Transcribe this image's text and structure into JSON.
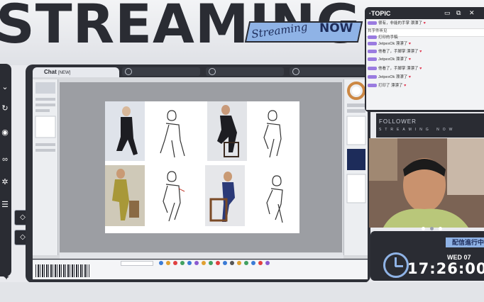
{
  "banner": {
    "word": "STREAMING",
    "tag_script": "Streaming",
    "tag_now": "NOW"
  },
  "sidebar": {
    "icons": [
      "chevron-down-icon",
      "refresh-icon",
      "eye-icon",
      "link-icon",
      "star-icon",
      "menu-icon"
    ],
    "diamond_buttons": [
      "◇",
      "◇"
    ]
  },
  "window": {
    "chat_tab": "Chat",
    "chat_tab_suffix": "[NEW]"
  },
  "topic": {
    "title": "·TOPIC",
    "rows": [
      {
        "user": "",
        "text": "很有，非能的手掌 漂漂了",
        "heart": "♥"
      },
      {
        "user": "",
        "text": "共字件听见 ",
        "heart": ""
      },
      {
        "user": "",
        "text": "打印的手稿",
        "heart": ""
      },
      {
        "user": "",
        "text": "JetpexOk 漂漂了",
        "heart": "♥"
      },
      {
        "user": "",
        "text": "他看了，手脚掌 漂漂了",
        "heart": "♥"
      },
      {
        "user": "",
        "text": "JetpexOk 漂漂了",
        "heart": "♥"
      },
      {
        "user": "",
        "text": "他看了，手脚掌 漂漂了",
        "heart": "♥"
      },
      {
        "user": "",
        "text": "JetpexOk 漂漂了",
        "heart": "♥"
      },
      {
        "user": "",
        "text": "打印了 漂漂了",
        "heart": "♥"
      }
    ]
  },
  "follower": {
    "title": "FOLLOWER",
    "subtitle": "STREAMING NOW"
  },
  "clock": {
    "live_label": "配信進行中",
    "day": "WED",
    "date": "07",
    "time": "17:26:00"
  },
  "colors": {
    "dark": "#2a2c33",
    "accent": "#8fb3e6",
    "badge": "#9a7be0",
    "heart": "#e0334c"
  }
}
